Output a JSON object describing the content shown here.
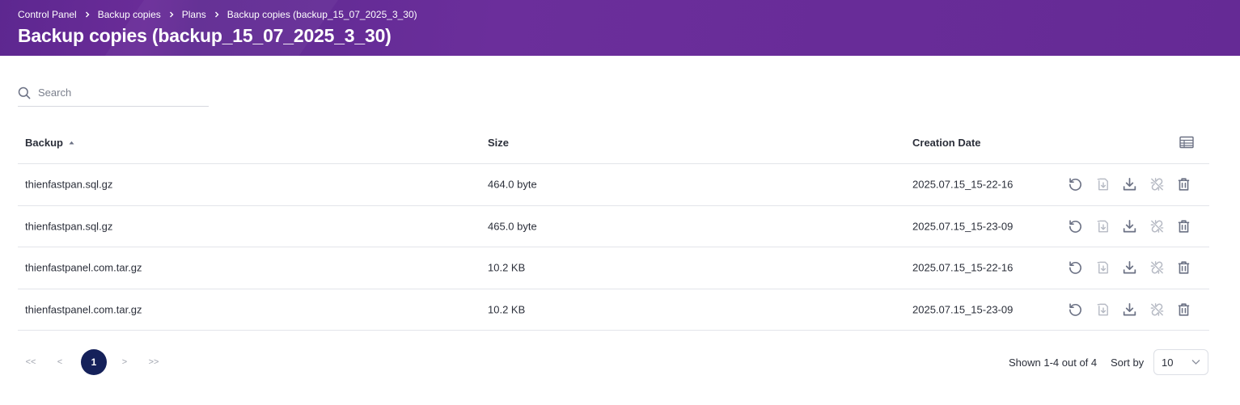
{
  "breadcrumb": {
    "items": [
      "Control Panel",
      "Backup copies",
      "Plans",
      "Backup copies (backup_15_07_2025_3_30)"
    ]
  },
  "page_title": "Backup copies (backup_15_07_2025_3_30)",
  "search": {
    "placeholder": "Search",
    "value": ""
  },
  "table": {
    "columns": {
      "backup": "Backup",
      "size": "Size",
      "creation_date": "Creation Date"
    },
    "sort": {
      "column": "Backup",
      "direction": "ascending"
    },
    "rows": [
      {
        "name": "thienfastpan.sql.gz",
        "size": "464.0 byte",
        "date": "2025.07.15_15-22-16"
      },
      {
        "name": "thienfastpan.sql.gz",
        "size": "465.0 byte",
        "date": "2025.07.15_15-23-09"
      },
      {
        "name": "thienfastpanel.com.tar.gz",
        "size": "10.2 KB",
        "date": "2025.07.15_15-22-16"
      },
      {
        "name": "thienfastpanel.com.tar.gz",
        "size": "10.2 KB",
        "date": "2025.07.15_15-23-09"
      }
    ],
    "row_actions": [
      "restore-icon",
      "file-restore-icon",
      "download-icon",
      "unlink-icon",
      "trash-icon"
    ]
  },
  "pagination": {
    "first": "<<",
    "prev": "<",
    "current": "1",
    "next": ">",
    "last": ">>"
  },
  "footer": {
    "shown_text": "Shown 1-4 out of 4",
    "sort_by_label": "Sort by",
    "per_page": "10"
  },
  "colors": {
    "header_bg": "#652a95",
    "page_bg": "#ffffff",
    "text": "#2b2f3a",
    "icon": "#6b7184",
    "icon_disabled": "#b6bac4",
    "pagination_active": "#15215a"
  }
}
